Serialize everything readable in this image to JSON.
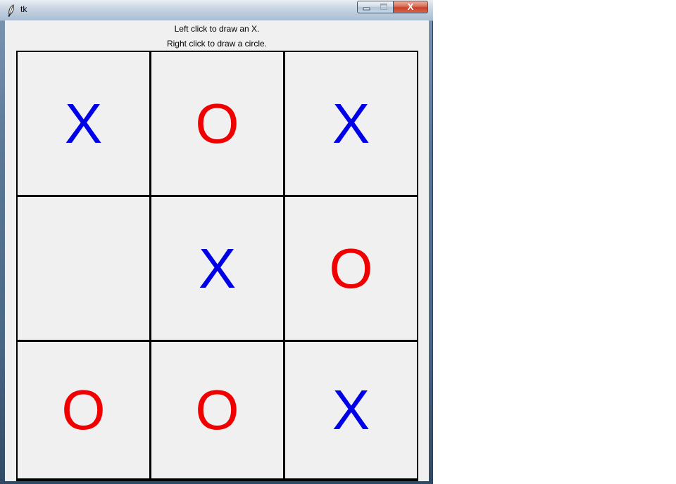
{
  "window": {
    "title": "tk",
    "close_glyph": "X",
    "icon": "feather-icon"
  },
  "instructions": {
    "line1": "Left click to draw an X.",
    "line2": "Right click to draw a circle."
  },
  "colors": {
    "x_color": "#0000e8",
    "o_color": "#f00000",
    "grid_color": "#000000",
    "cell_background": "#f0f0f0"
  },
  "board": {
    "cells": [
      {
        "row": 1,
        "col": 1,
        "mark": "X"
      },
      {
        "row": 1,
        "col": 2,
        "mark": "O"
      },
      {
        "row": 1,
        "col": 3,
        "mark": "X"
      },
      {
        "row": 2,
        "col": 1,
        "mark": ""
      },
      {
        "row": 2,
        "col": 2,
        "mark": "X"
      },
      {
        "row": 2,
        "col": 3,
        "mark": "O"
      },
      {
        "row": 3,
        "col": 1,
        "mark": "O"
      },
      {
        "row": 3,
        "col": 2,
        "mark": "O"
      },
      {
        "row": 3,
        "col": 3,
        "mark": "X"
      }
    ]
  }
}
